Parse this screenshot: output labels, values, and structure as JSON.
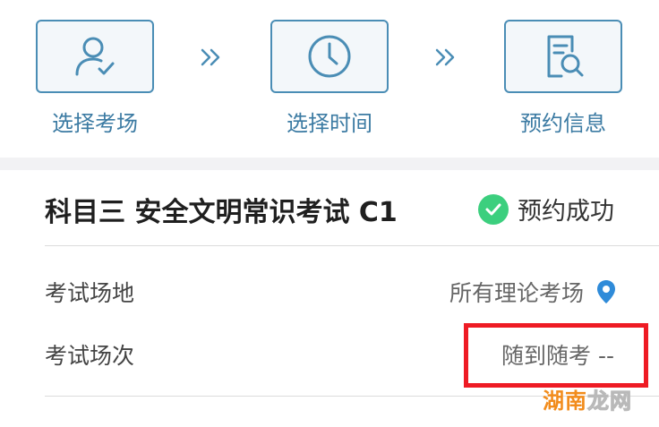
{
  "steps": [
    {
      "label": "选择考场",
      "icon": "user-check-icon"
    },
    {
      "label": "选择时间",
      "icon": "clock-icon"
    },
    {
      "label": "预约信息",
      "icon": "document-search-icon"
    }
  ],
  "exam": {
    "title": "科目三 安全文明常识考试 C1",
    "status": "预约成功"
  },
  "rows": [
    {
      "label": "考试场地",
      "value": "所有理论考场"
    },
    {
      "label": "考试场次",
      "value": "随到随考 --"
    }
  ],
  "watermark": {
    "part1": "湖",
    "part2": "南",
    "part3": "龙网"
  },
  "colors": {
    "accent": "#4a8db5",
    "success": "#3ccf7e",
    "highlight": "#ee1b24",
    "location_pin": "#2f8bd9"
  }
}
